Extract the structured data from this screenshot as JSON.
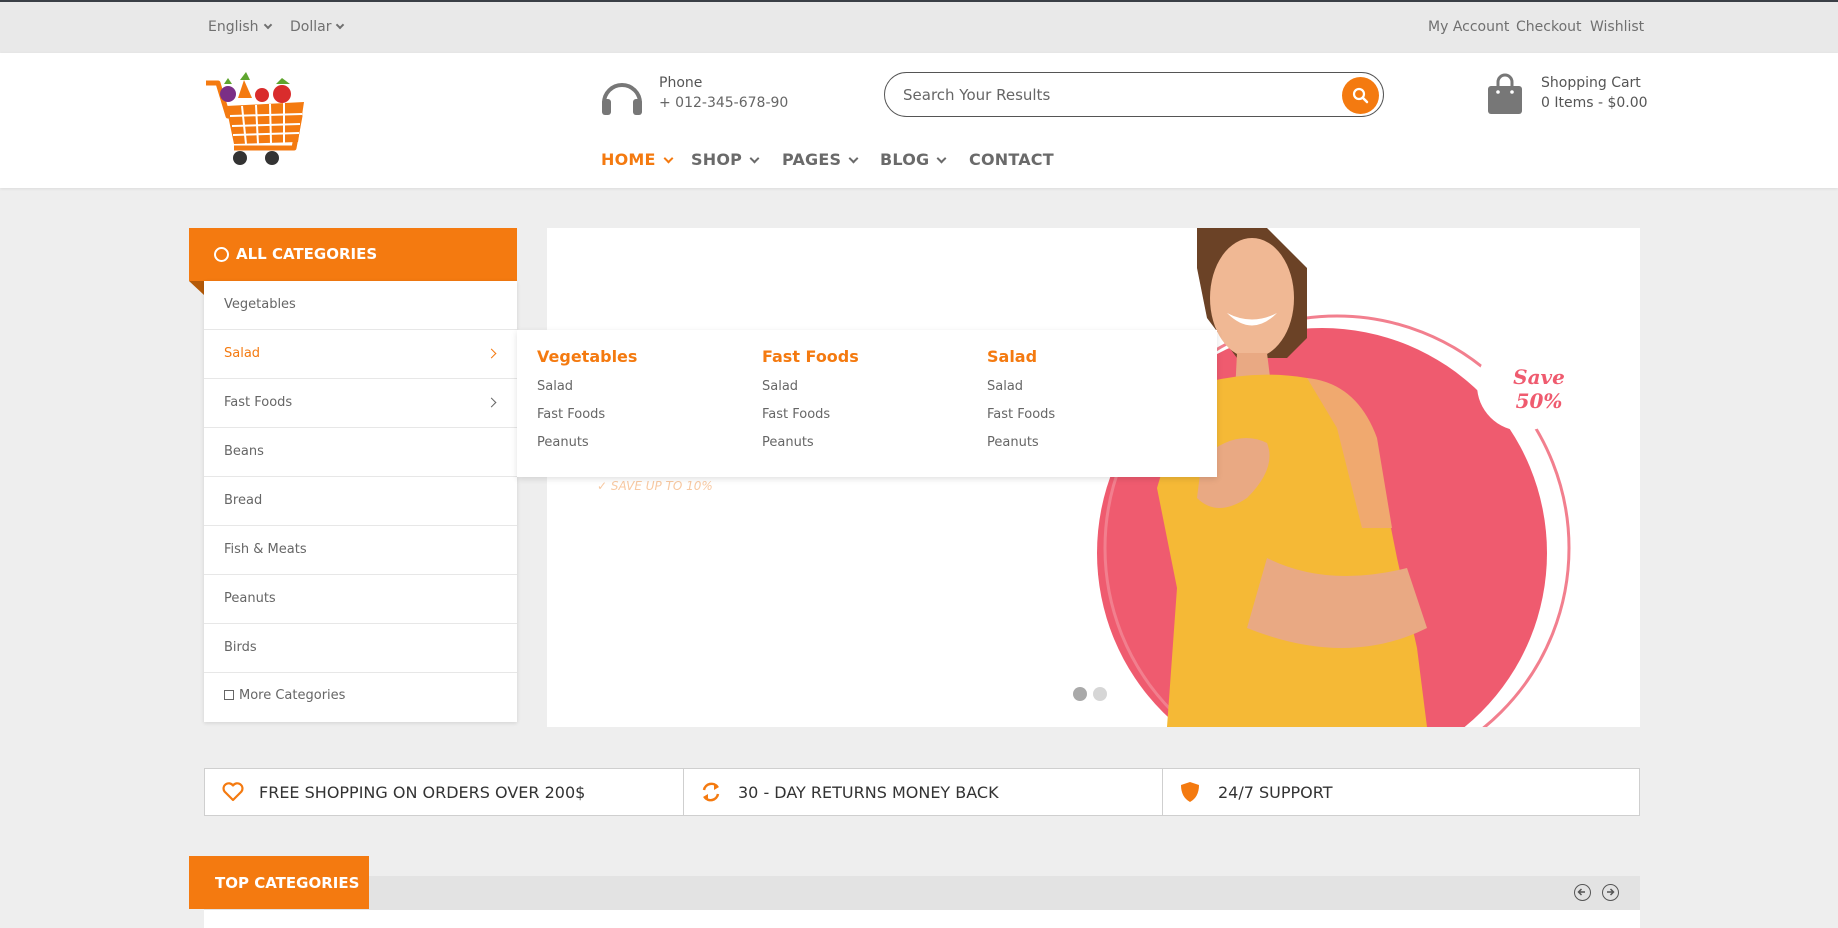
{
  "topbar": {
    "language": "English",
    "currency": "Dollar",
    "links": [
      "My Account",
      "Checkout",
      "Wishlist"
    ]
  },
  "header": {
    "phone_label": "Phone",
    "phone_number": "+ 012-345-678-90",
    "search_placeholder": "Search Your Results",
    "cart_title": "Shopping Cart",
    "cart_info": "0 Items - $0.00"
  },
  "nav": {
    "items": [
      "HOME",
      "SHOP",
      "PAGES",
      "BLOG",
      "CONTACT"
    ],
    "active": "HOME"
  },
  "categories": {
    "header": "ALL CATEGORIES",
    "items": [
      "Vegetables",
      "Salad",
      "Fast Foods",
      "Beans",
      "Bread",
      "Fish & Meats",
      "Peanuts",
      "Birds"
    ],
    "active": "Salad",
    "more": "More Categories"
  },
  "mega_menu": {
    "columns": [
      {
        "title": "Vegetables",
        "links": [
          "Salad",
          "Fast Foods",
          "Peanuts"
        ]
      },
      {
        "title": "Fast Foods",
        "links": [
          "Salad",
          "Fast Foods",
          "Peanuts"
        ]
      },
      {
        "title": "Salad",
        "links": [
          "Salad",
          "Fast Foods",
          "Peanuts"
        ]
      }
    ]
  },
  "slider": {
    "save_up": "SAVE UP TO 10%",
    "badge_line1": "Save",
    "badge_line2": "50%",
    "slide_count": 2,
    "active_slide": 1
  },
  "features": [
    {
      "text": "FREE SHOPPING ON ORDERS OVER 200$",
      "icon": "heart-icon"
    },
    {
      "text": "30 - DAY RETURNS MONEY BACK",
      "icon": "refresh-icon"
    },
    {
      "text": "24/7 SUPPORT",
      "icon": "shield-icon"
    }
  ],
  "top_categories": {
    "title": "TOP CATEGORIES"
  },
  "colors": {
    "accent": "#f47a10",
    "topbar_bg": "#e9e9e9",
    "page_bg": "#eeeeee",
    "circle": "#ef5b6f"
  }
}
